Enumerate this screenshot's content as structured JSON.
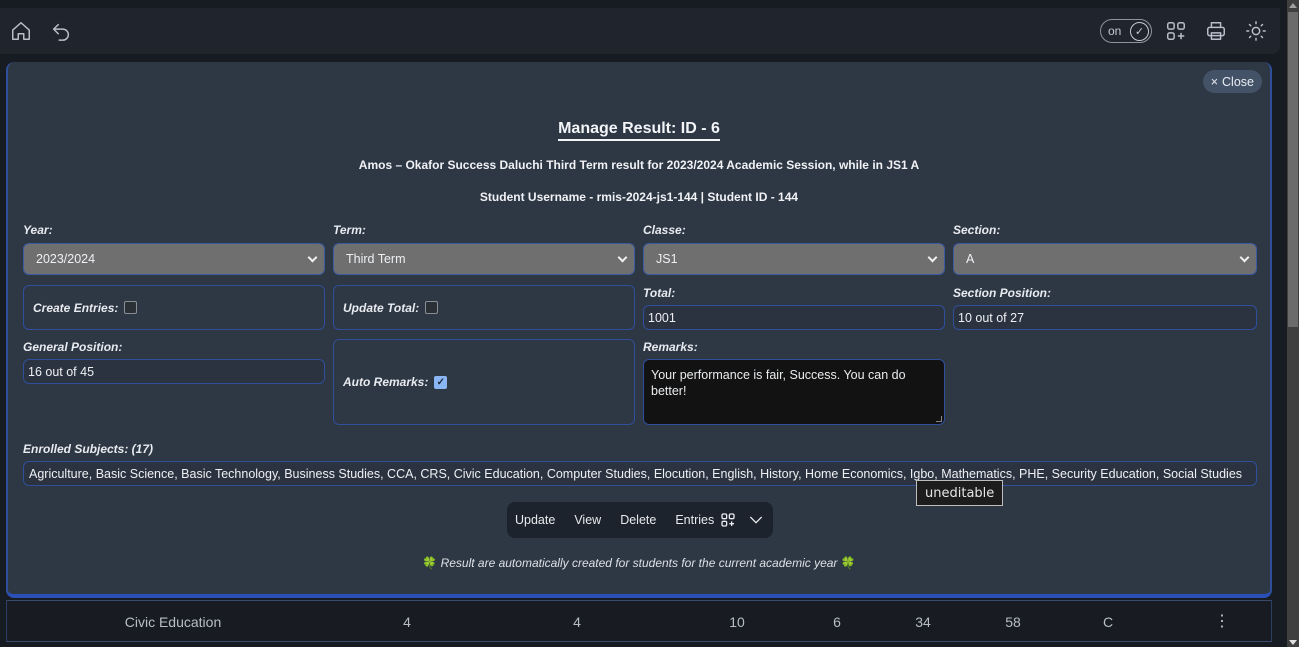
{
  "topbar": {
    "toggle_label": "on",
    "icons": [
      "home-icon",
      "undo-icon",
      "apps-add-icon",
      "printer-icon",
      "sun-icon"
    ]
  },
  "modal": {
    "close_label": "Close",
    "title": "Manage Result: ID - 6",
    "subtitle": "Amos – Okafor Success Daluchi Third Term result for 2023/2024 Academic Session, while in JS1 A",
    "student_line": "Student Username - rmis-2024-js1-144 | Student ID - 144",
    "fields": {
      "year": {
        "label": "Year:",
        "value": "2023/2024"
      },
      "term": {
        "label": "Term:",
        "value": "Third Term"
      },
      "classe": {
        "label": "Classe:",
        "value": "JS1"
      },
      "section": {
        "label": "Section:",
        "value": "A"
      },
      "create_entries": {
        "label": "Create Entries:",
        "checked": false
      },
      "update_total": {
        "label": "Update Total:",
        "checked": false
      },
      "total": {
        "label": "Total:",
        "value": "1001"
      },
      "section_position": {
        "label": "Section Position:",
        "value": "10 out of 27"
      },
      "general_position": {
        "label": "General Position:",
        "value": "16 out of 45"
      },
      "auto_remarks": {
        "label": "Auto Remarks:",
        "checked": true
      },
      "remarks": {
        "label": "Remarks:",
        "value": "Your performance is fair, Success. You can do better!"
      },
      "enrolled_subjects": {
        "label": "Enrolled Subjects: (17)",
        "value": "Agriculture, Basic Science, Basic Technology, Business Studies, CCA, CRS, Civic Education, Computer Studies, Elocution, English, History, Home Economics, Igbo, Mathematics, PHE, Security Education, Social Studies"
      }
    },
    "tooltip": "uneditable",
    "actions": {
      "update": "Update",
      "view": "View",
      "delete": "Delete",
      "entries": "Entries"
    },
    "note_leaf": "🍀",
    "note": "Result are automatically created for students for the current academic year"
  },
  "table_row": {
    "subject": "Civic Education",
    "values": [
      "4",
      "4",
      "10",
      "6",
      "34",
      "58",
      "C"
    ],
    "menu": "⋮"
  },
  "colors": {
    "accent_border": "#2f4f9a",
    "modal_bg": "#2e3744",
    "select_bg": "#6f6f6f",
    "checkbox_checked": "#8ab6f5"
  }
}
